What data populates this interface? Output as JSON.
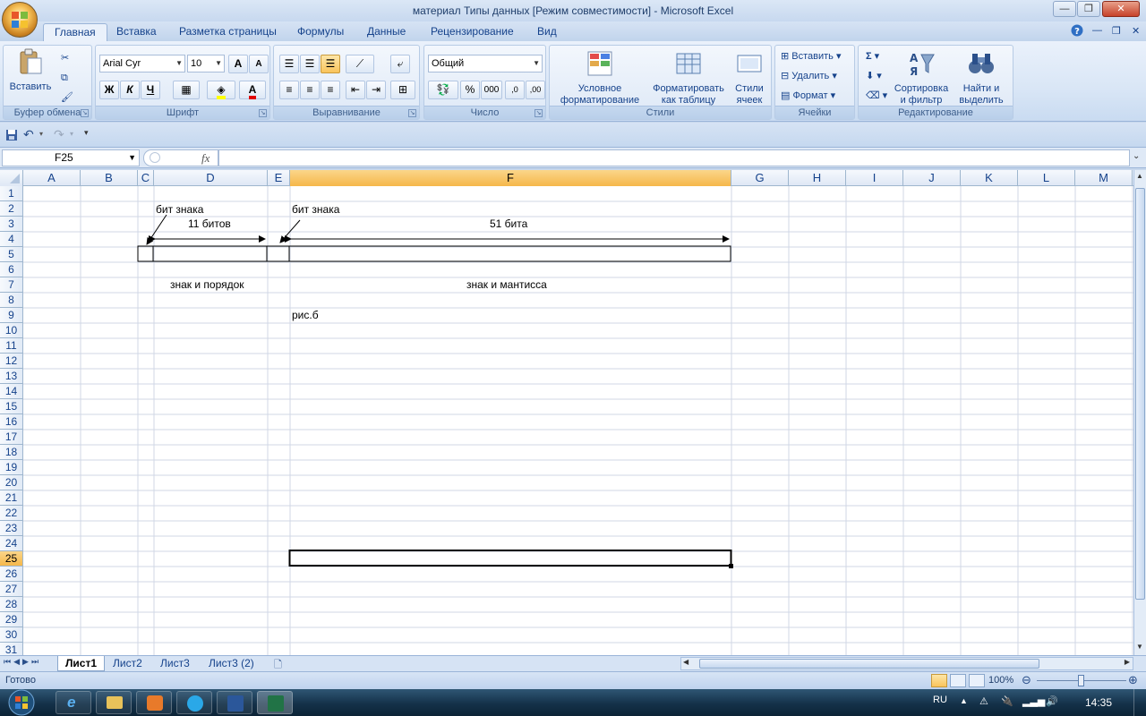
{
  "window": {
    "title": "материал Типы данных  [Режим совместимости] - Microsoft Excel",
    "min_label": "—",
    "max_label": "❐",
    "close_label": "✕"
  },
  "ribbon_tabs": [
    "Главная",
    "Вставка",
    "Разметка страницы",
    "Формулы",
    "Данные",
    "Рецензирование",
    "Вид"
  ],
  "ribbon": {
    "clipboard": {
      "label": "Буфер обмена",
      "paste": "Вставить"
    },
    "font": {
      "label": "Шрифт",
      "name": "Arial Cyr",
      "size": "10",
      "bold": "Ж",
      "italic": "К",
      "underline": "Ч",
      "grow": "A",
      "shrink": "A",
      "color": "A"
    },
    "alignment": {
      "label": "Выравнивание"
    },
    "number": {
      "label": "Число",
      "format": "Общий",
      "percent": "%",
      "thousands": "000",
      "inc_dec": ",0",
      "dec_dec": ",00"
    },
    "styles": {
      "label": "Стили",
      "conditional_line1": "Условное",
      "conditional_line2": "форматирование",
      "table_line1": "Форматировать",
      "table_line2": "как таблицу",
      "cell_line1": "Стили",
      "cell_line2": "ячеек"
    },
    "cells": {
      "label": "Ячейки",
      "insert": "Вставить",
      "delete": "Удалить",
      "format": "Формат"
    },
    "editing": {
      "label": "Редактирование",
      "sort_line1": "Сортировка",
      "sort_line2": "и фильтр",
      "find_line1": "Найти и",
      "find_line2": "выделить",
      "sum": "Σ"
    }
  },
  "formula_bar": {
    "name_box": "F25",
    "fx": "fx",
    "value": ""
  },
  "columns": [
    "A",
    "B",
    "C",
    "D",
    "E",
    "F",
    "G",
    "H",
    "I",
    "J",
    "K",
    "L",
    "M"
  ],
  "selected_column": "F",
  "rows": [
    "1",
    "2",
    "3",
    "4",
    "5",
    "6",
    "7",
    "8",
    "9",
    "10",
    "11",
    "12",
    "13",
    "14",
    "15",
    "16",
    "17",
    "18",
    "19",
    "20",
    "21",
    "22",
    "23",
    "24",
    "25",
    "26",
    "27",
    "28",
    "29",
    "30",
    "31"
  ],
  "selected_row": "25",
  "cells": {
    "c2": "бит знака",
    "d3": "11 битов",
    "e2": "бит знака",
    "f3": "51 бита",
    "d7": "знак и порядок",
    "f7": "знак и мантисса",
    "e9": "рис.б"
  },
  "sheets": [
    "Лист1",
    "Лист2",
    "Лист3",
    "Лист3 (2)"
  ],
  "active_sheet": "Лист1",
  "status": {
    "ready": "Готово",
    "zoom": "100%"
  },
  "taskbar": {
    "lang": "RU",
    "time": "14:35"
  }
}
